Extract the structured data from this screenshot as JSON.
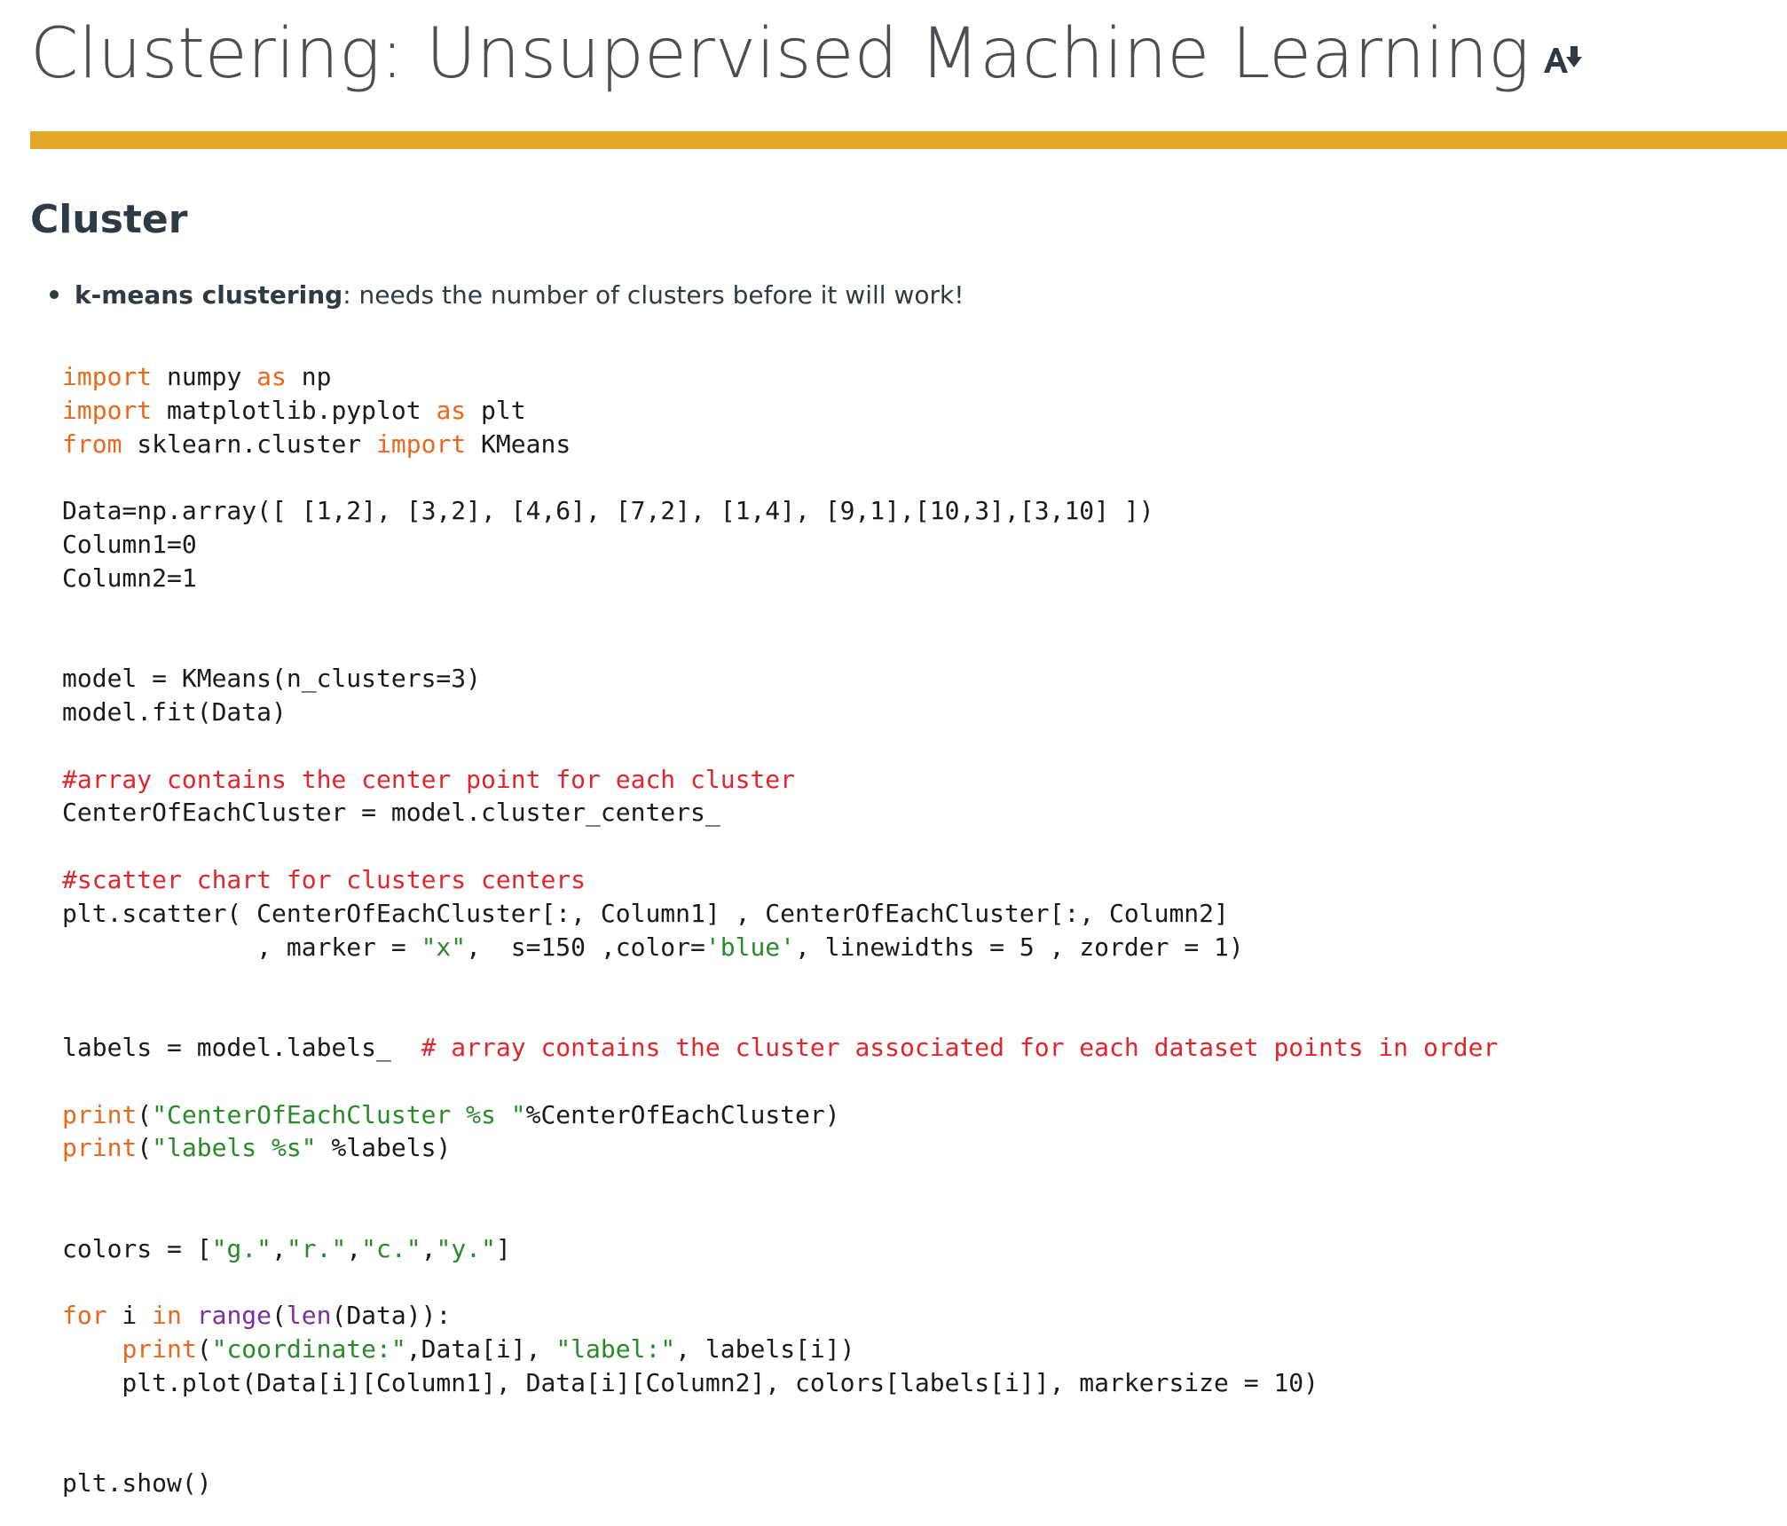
{
  "page": {
    "title": "Clustering: Unsupervised Machine Learning",
    "immersive_reader_icon": "immersive-reader-icon"
  },
  "colors": {
    "title_rule": "#e5a72a",
    "keyword": "#e8691e",
    "string": "#2a8a2a",
    "comment": "#e0262d",
    "builtin": "#7b2fa0",
    "text": "#2d3b45"
  },
  "section": {
    "heading": "Cluster",
    "bullets": [
      {
        "term": "k-means clustering",
        "text": ": needs the number of clusters before it will work!"
      }
    ]
  },
  "code": {
    "lines": [
      [
        {
          "t": "import",
          "c": "kw"
        },
        {
          "t": " numpy ",
          "c": "plain"
        },
        {
          "t": "as",
          "c": "kw"
        },
        {
          "t": " np",
          "c": "plain"
        }
      ],
      [
        {
          "t": "import",
          "c": "kw"
        },
        {
          "t": " matplotlib.pyplot ",
          "c": "plain"
        },
        {
          "t": "as",
          "c": "kw"
        },
        {
          "t": " plt",
          "c": "plain"
        }
      ],
      [
        {
          "t": "from",
          "c": "kw"
        },
        {
          "t": " sklearn.cluster ",
          "c": "plain"
        },
        {
          "t": "import",
          "c": "kw"
        },
        {
          "t": " KMeans",
          "c": "plain"
        }
      ],
      [],
      [
        {
          "t": "Data=np.array([ [1,2], [3,2], [4,6], [7,2], [1,4], [9,1],[10,3],[3,10] ])",
          "c": "plain"
        }
      ],
      [
        {
          "t": "Column1=0",
          "c": "plain"
        }
      ],
      [
        {
          "t": "Column2=1",
          "c": "plain"
        }
      ],
      [],
      [],
      [
        {
          "t": "model = KMeans(n_clusters=3)",
          "c": "plain"
        }
      ],
      [
        {
          "t": "model.fit(Data)",
          "c": "plain"
        }
      ],
      [],
      [
        {
          "t": "#array contains the center point for each cluster",
          "c": "cmt"
        }
      ],
      [
        {
          "t": "CenterOfEachCluster = model.cluster_centers_",
          "c": "plain"
        }
      ],
      [],
      [
        {
          "t": "#scatter chart for clusters centers",
          "c": "cmt"
        }
      ],
      [
        {
          "t": "plt.scatter( CenterOfEachCluster[:, Column1] , CenterOfEachCluster[:, Column2]",
          "c": "plain"
        }
      ],
      [
        {
          "t": "             , marker = ",
          "c": "plain"
        },
        {
          "t": "\"x\"",
          "c": "str"
        },
        {
          "t": ",  s=150 ,color=",
          "c": "plain"
        },
        {
          "t": "'blue'",
          "c": "str"
        },
        {
          "t": ", linewidths = 5 , zorder = 1)",
          "c": "plain"
        }
      ],
      [],
      [],
      [
        {
          "t": "labels = model.labels_  ",
          "c": "plain"
        },
        {
          "t": "# array contains the cluster associated for each dataset points in order",
          "c": "cmt"
        }
      ],
      [],
      [
        {
          "t": "print",
          "c": "kw"
        },
        {
          "t": "(",
          "c": "plain"
        },
        {
          "t": "\"CenterOfEachCluster %s \"",
          "c": "str"
        },
        {
          "t": "%CenterOfEachCluster)",
          "c": "plain"
        }
      ],
      [
        {
          "t": "print",
          "c": "kw"
        },
        {
          "t": "(",
          "c": "plain"
        },
        {
          "t": "\"labels %s\"",
          "c": "str"
        },
        {
          "t": " %labels)",
          "c": "plain"
        }
      ],
      [],
      [],
      [
        {
          "t": "colors = [",
          "c": "plain"
        },
        {
          "t": "\"g.\"",
          "c": "str"
        },
        {
          "t": ",",
          "c": "plain"
        },
        {
          "t": "\"r.\"",
          "c": "str"
        },
        {
          "t": ",",
          "c": "plain"
        },
        {
          "t": "\"c.\"",
          "c": "str"
        },
        {
          "t": ",",
          "c": "plain"
        },
        {
          "t": "\"y.\"",
          "c": "str"
        },
        {
          "t": "]",
          "c": "plain"
        }
      ],
      [],
      [
        {
          "t": "for",
          "c": "kw"
        },
        {
          "t": " i ",
          "c": "plain"
        },
        {
          "t": "in",
          "c": "kw"
        },
        {
          "t": " ",
          "c": "plain"
        },
        {
          "t": "range",
          "c": "fn"
        },
        {
          "t": "(",
          "c": "plain"
        },
        {
          "t": "len",
          "c": "fn"
        },
        {
          "t": "(Data)):",
          "c": "plain"
        }
      ],
      [
        {
          "t": "    ",
          "c": "plain"
        },
        {
          "t": "print",
          "c": "kw"
        },
        {
          "t": "(",
          "c": "plain"
        },
        {
          "t": "\"coordinate:\"",
          "c": "str"
        },
        {
          "t": ",Data[i], ",
          "c": "plain"
        },
        {
          "t": "\"label:\"",
          "c": "str"
        },
        {
          "t": ", labels[i])",
          "c": "plain"
        }
      ],
      [
        {
          "t": "    plt.plot(Data[i][Column1], Data[i][Column2], colors[labels[i]], markersize = 10)",
          "c": "plain"
        }
      ],
      [],
      [],
      [
        {
          "t": "plt.show()",
          "c": "plain"
        }
      ]
    ]
  }
}
